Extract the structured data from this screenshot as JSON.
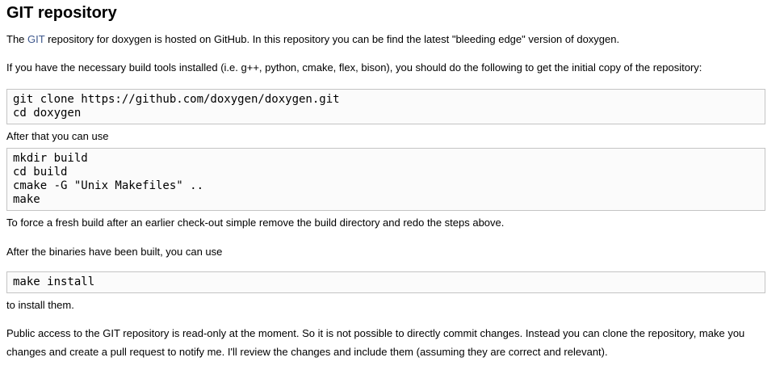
{
  "heading": "GIT repository",
  "intro": {
    "prefix": "The ",
    "link": "GIT",
    "suffix": " repository for doxygen is hosted on GitHub. In this repository you can be find the latest \"bleeding edge\" version of doxygen."
  },
  "build_tools_text": "If you have the necessary build tools installed (i.e. g++, python, cmake, flex, bison), you should do the following to get the initial copy of the repository:",
  "clone_code": [
    "git clone https://github.com/doxygen/doxygen.git",
    "cd doxygen"
  ],
  "after_that_text": "After that you can use",
  "build_code": [
    "mkdir build",
    "cd build",
    "cmake -G \"Unix Makefiles\" ..",
    "make"
  ],
  "fresh_build_text": "To force a fresh build after an earlier check-out simple remove the build directory and redo the steps above.",
  "after_binaries_text": "After the binaries have been built, you can use",
  "install_code": [
    "make install"
  ],
  "install_them_text": "to install them.",
  "public_access_text": "Public access to the GIT repository is read-only at the moment. So it is not possible to directly commit changes. Instead you can clone the repository, make you changes and create a pull request to notify me. I'll review the changes and include them (assuming they are correct and relevant).",
  "colors": {
    "link": "#3d578c",
    "code_background": "#fbfbfb",
    "code_border": "#c4c4c4"
  }
}
